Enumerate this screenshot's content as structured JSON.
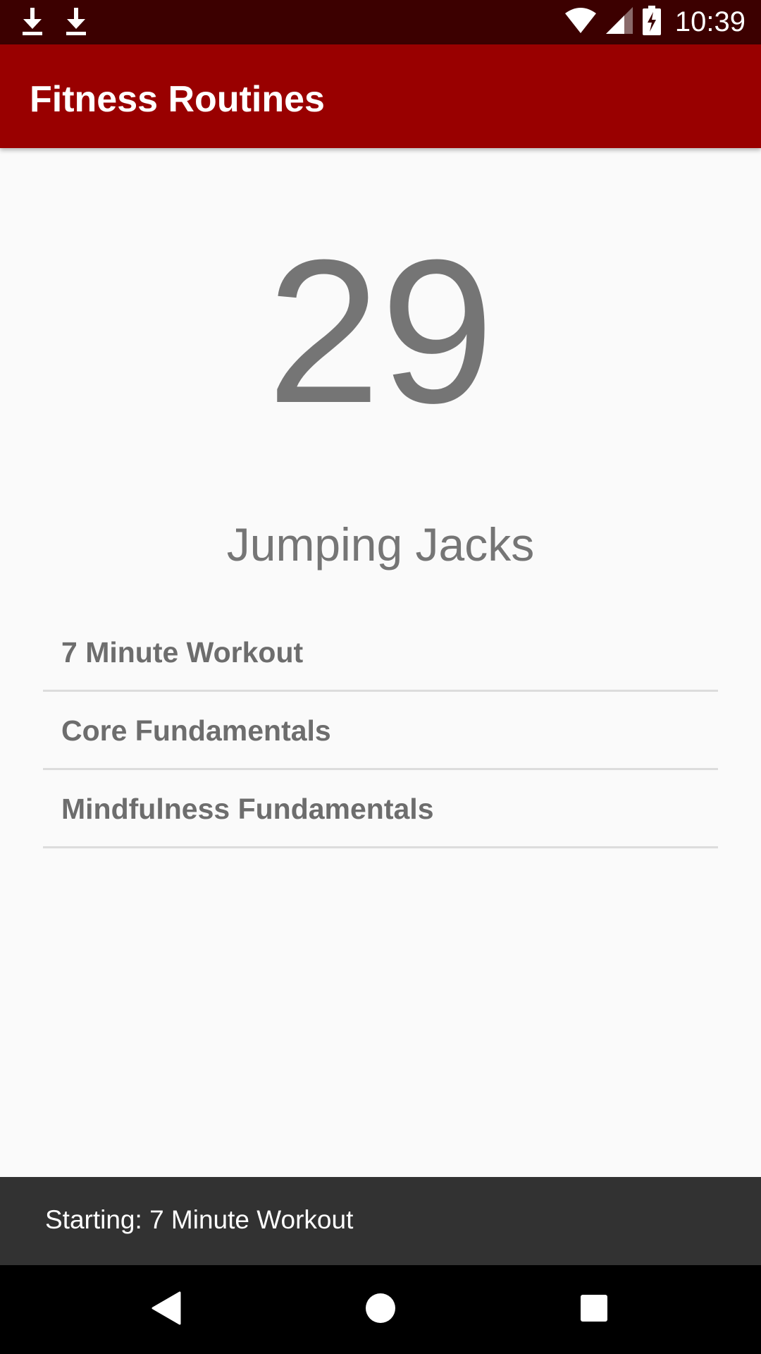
{
  "status_bar": {
    "time": "10:39",
    "left_icons": [
      "download-icon",
      "download-icon"
    ],
    "right_icons": [
      "wifi-icon",
      "cell-signal-icon",
      "battery-charging-icon"
    ],
    "background": "#3c0000"
  },
  "app_bar": {
    "title": "Fitness Routines",
    "background": "#990000"
  },
  "workout": {
    "counter": "29",
    "exercise": "Jumping Jacks"
  },
  "routines": [
    {
      "label": "7 Minute Workout"
    },
    {
      "label": "Core Fundamentals"
    },
    {
      "label": "Mindfulness Fundamentals"
    }
  ],
  "snackbar": {
    "message": "Starting: 7 Minute Workout"
  },
  "nav_bar": {
    "buttons": [
      "back-icon",
      "home-icon",
      "recents-icon"
    ]
  }
}
